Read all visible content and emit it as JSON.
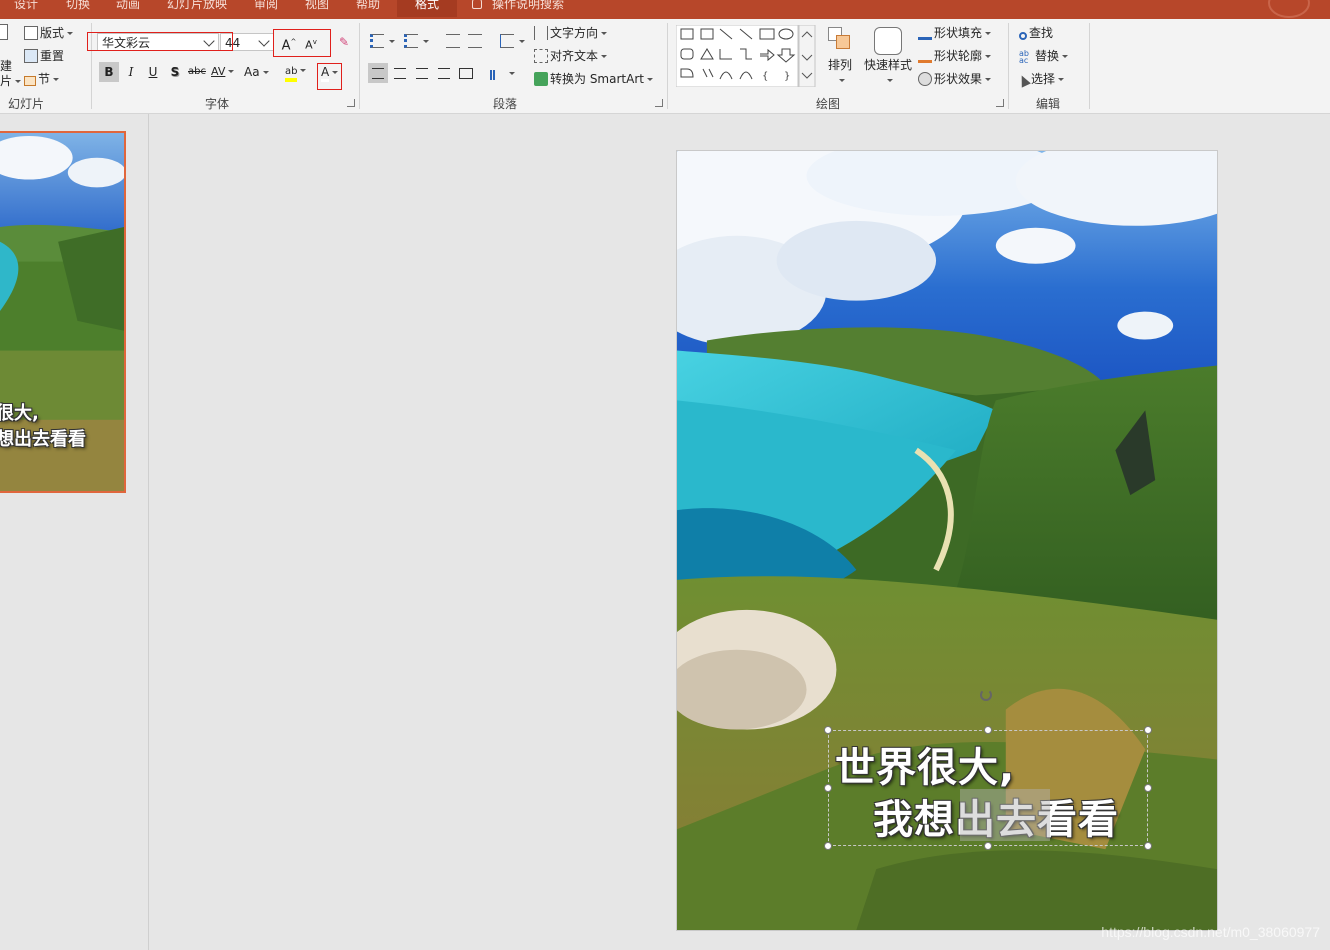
{
  "tabs": [
    {
      "label": "设计"
    },
    {
      "label": "切换"
    },
    {
      "label": "动画"
    },
    {
      "label": "幻灯片放映"
    },
    {
      "label": "审阅"
    },
    {
      "label": "视图"
    },
    {
      "label": "帮助"
    },
    {
      "label": "格式"
    },
    {
      "label": "操作说明搜索"
    }
  ],
  "ribbon": {
    "slides": {
      "layout": "版式",
      "reset": "重置",
      "section": "节",
      "new_top": "建",
      "new_bottom": "片",
      "group_label": "幻灯片"
    },
    "font": {
      "font_name": "华文彩云",
      "font_size": "44",
      "grow_glyph": "A",
      "shrink_glyph": "A",
      "bold": "B",
      "italic": "I",
      "underline": "U",
      "shadow": "S",
      "strike": "abc",
      "spacing": "AV",
      "case": "Aa",
      "highlight": "ab",
      "font_color": "A",
      "group_label": "字体"
    },
    "paragraph": {
      "text_direction": "文字方向",
      "align_text": "对齐文本",
      "smartart": "转换为 SmartArt",
      "group_label": "段落"
    },
    "drawing": {
      "arrange": "排列",
      "quick_styles": "快速样式",
      "shape_fill": "形状填充",
      "shape_outline": "形状轮廓",
      "shape_effects": "形状效果",
      "group_label": "绘图"
    },
    "editing": {
      "find": "查找",
      "replace": "替换",
      "select": "选择",
      "group_label": "编辑"
    }
  },
  "slide": {
    "line1": "世界很大,",
    "line2": "我想出去看看"
  },
  "thumbnail": {
    "line1": "很大,",
    "line2": "想出去看看"
  },
  "watermark": "https://blog.csdn.net/m0_38060977",
  "colors": {
    "accent": "#b7472a",
    "selection": "#e0663c",
    "highlight_yellow": "#ffff00"
  }
}
